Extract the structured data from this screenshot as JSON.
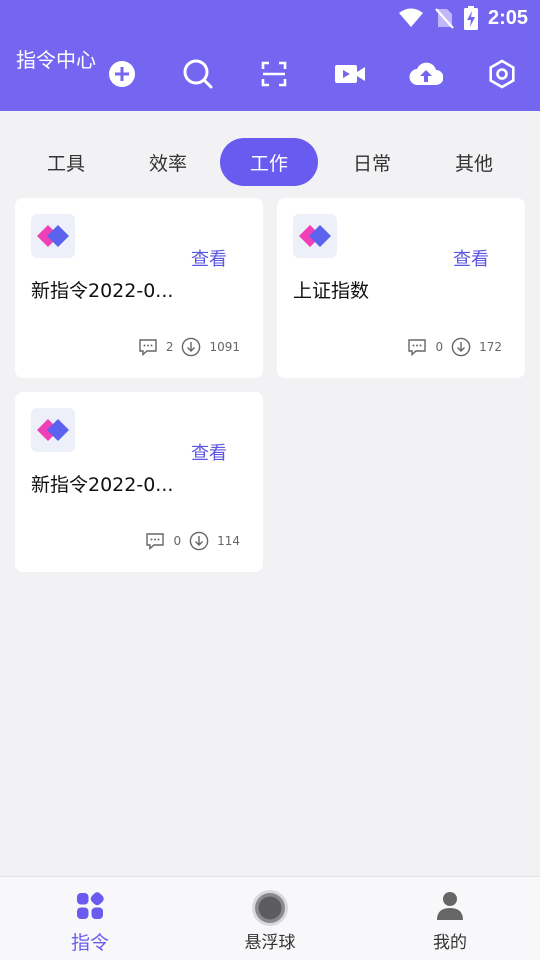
{
  "status_bar": {
    "time": "2:05"
  },
  "header": {
    "title": "指令中心",
    "accent_color": "#7566f2",
    "buttons": [
      "add-icon",
      "search-icon",
      "scan-icon",
      "video-icon",
      "cloud-upload-icon",
      "settings-icon"
    ]
  },
  "tabs": {
    "items": [
      {
        "label": "工具"
      },
      {
        "label": "效率"
      },
      {
        "label": "工作"
      },
      {
        "label": "日常"
      },
      {
        "label": "其他"
      }
    ],
    "selected": "工作"
  },
  "cards": [
    {
      "title": "新指令2022-0...",
      "view_label": "查看",
      "comments": "2",
      "downloads": "1091"
    },
    {
      "title": "上证指数",
      "view_label": "查看",
      "comments": "0",
      "downloads": "172"
    },
    {
      "title": "新指令2022-0...",
      "view_label": "查看",
      "comments": "0",
      "downloads": "114"
    }
  ],
  "bottom_nav": {
    "items": [
      {
        "label": "指令",
        "icon": "grid-icon"
      },
      {
        "label": "悬浮球",
        "icon": "floating-ball-icon"
      },
      {
        "label": "我的",
        "icon": "person-icon"
      }
    ],
    "selected": "指令"
  }
}
